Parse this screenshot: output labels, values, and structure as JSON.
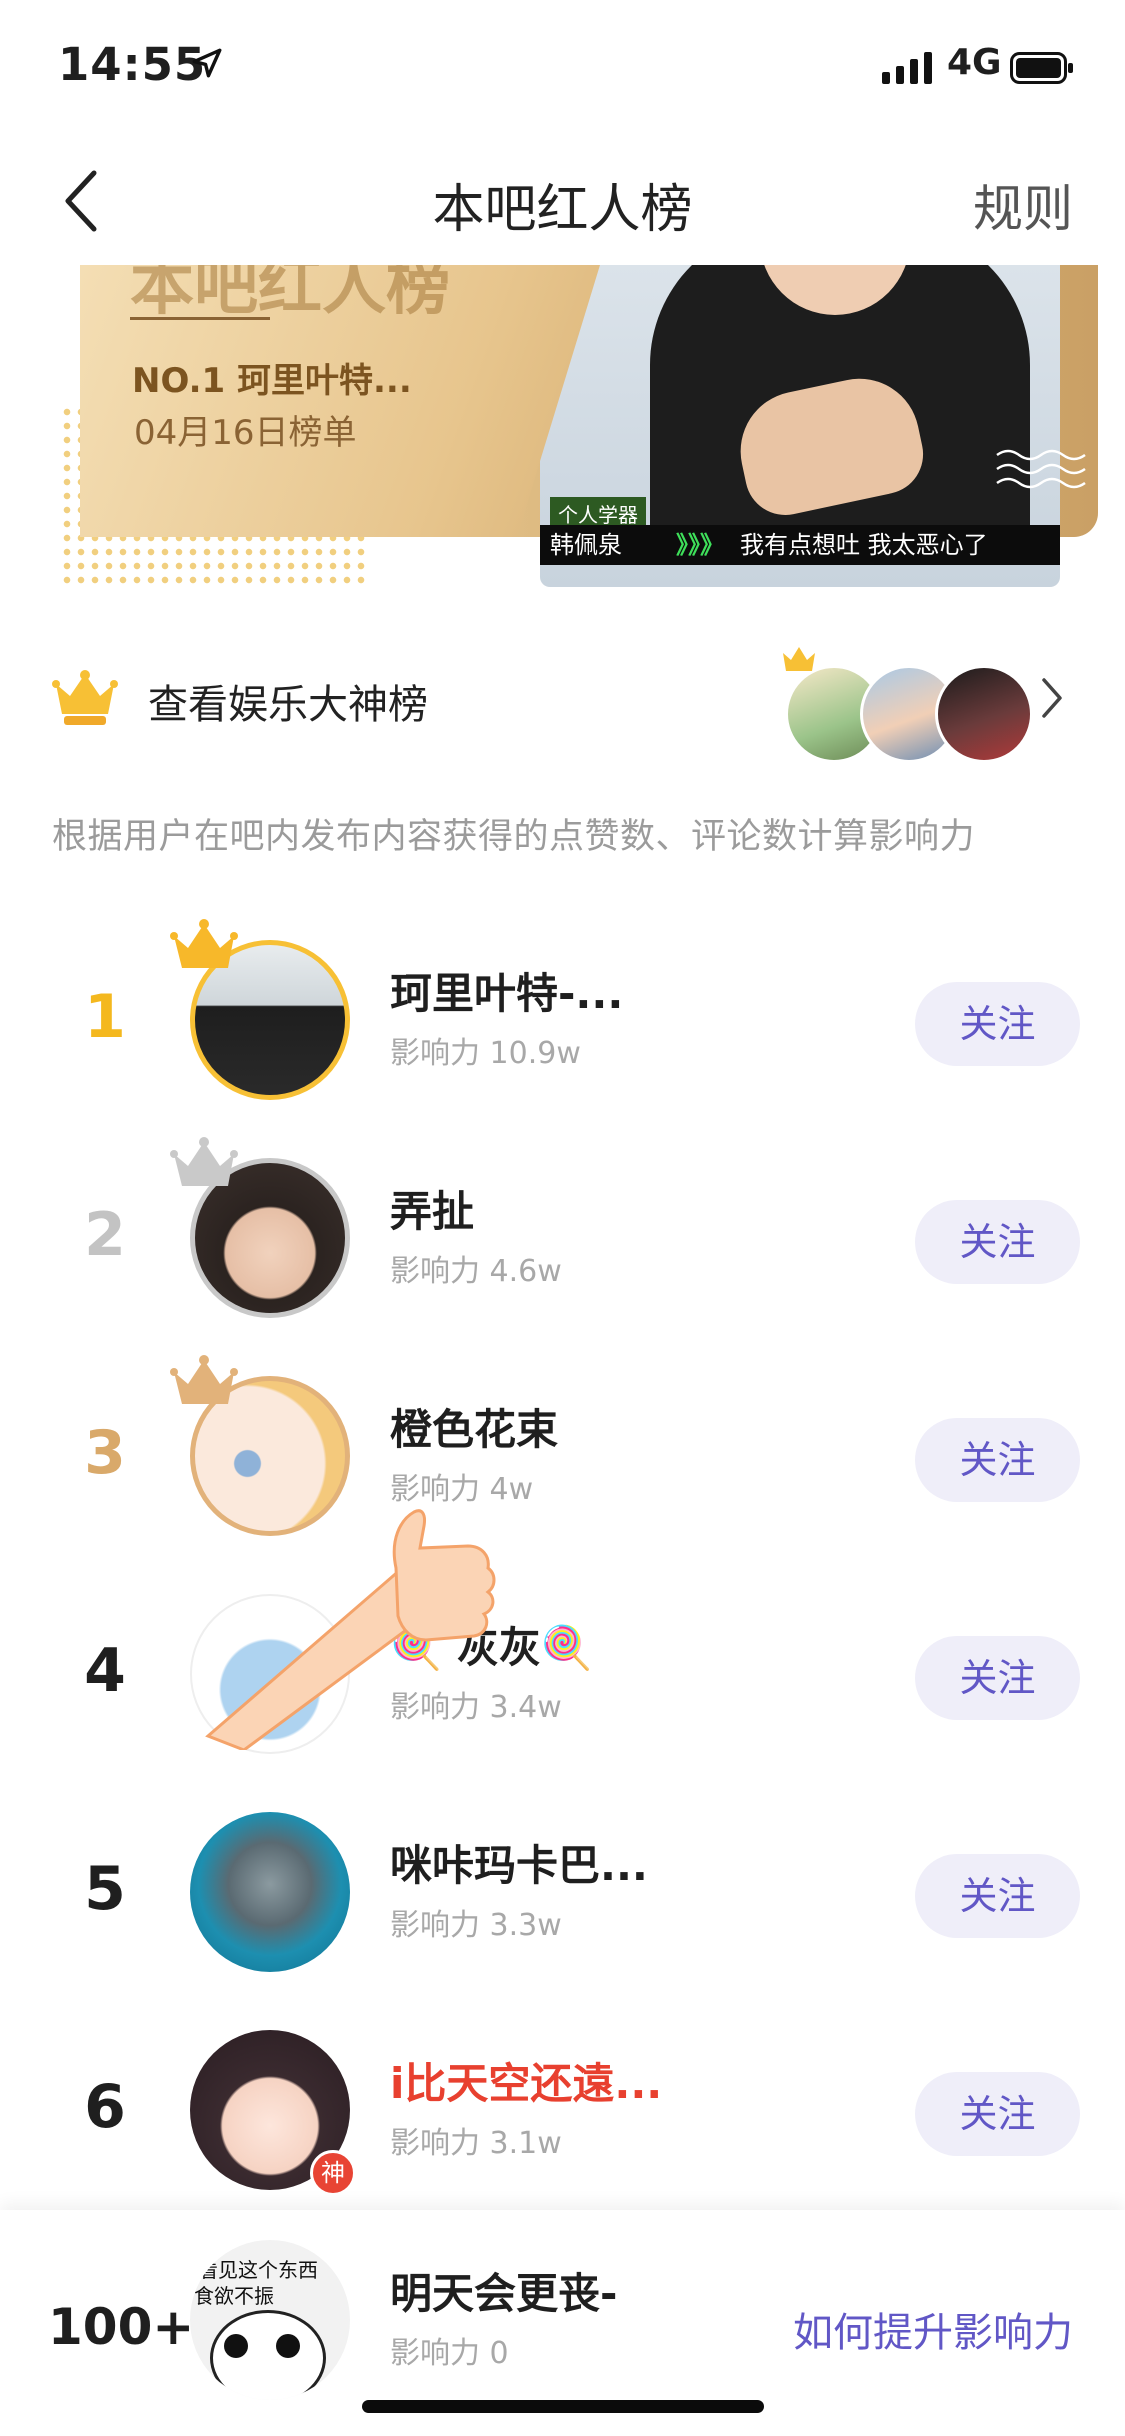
{
  "status_bar": {
    "time": "14:55",
    "network": "4G"
  },
  "nav": {
    "title": "本吧红人榜",
    "rules": "规则"
  },
  "banner": {
    "title": "本吧红人榜",
    "top_user": "NO.1 珂里叶特...",
    "date": "04月16日榜单",
    "caption_tag": "个人学器",
    "caption_name": "韩佩泉",
    "caption_arrows": "》》》",
    "caption_text": "我有点想吐 我太恶心了"
  },
  "entertainment": {
    "label": "查看娱乐大神榜"
  },
  "description": "根据用户在吧内发布内容获得的点赞数、评论数计算影响力",
  "ranking": [
    {
      "rank": "1",
      "name": "珂里叶特-...",
      "influence": "影响力 10.9w",
      "follow": "关注",
      "rank_color": "#f4b81e",
      "name_color": "#1f1f1f"
    },
    {
      "rank": "2",
      "name": "弄扯",
      "influence": "影响力 4.6w",
      "follow": "关注",
      "rank_color": "#c3c3c3",
      "name_color": "#1f1f1f"
    },
    {
      "rank": "3",
      "name": "橙色花束",
      "influence": "影响力 4w",
      "follow": "关注",
      "rank_color": "#d9a96a",
      "name_color": "#1f1f1f"
    },
    {
      "rank": "4",
      "name": "🍭 灰灰🍭",
      "influence": "影响力 3.4w",
      "follow": "关注",
      "rank_color": "#1f1f1f",
      "name_color": "#1f1f1f"
    },
    {
      "rank": "5",
      "name": "咪咔玛卡巴...",
      "influence": "影响力 3.3w",
      "follow": "关注",
      "rank_color": "#1f1f1f",
      "name_color": "#1f1f1f"
    },
    {
      "rank": "6",
      "name": "i比天空还遠...",
      "influence": "影响力 3.1w",
      "follow": "关注",
      "rank_color": "#1f1f1f",
      "name_color": "#e8402f",
      "badge": "神"
    }
  ],
  "me": {
    "rank": "100+",
    "name": "明天会更丧-",
    "influence": "影响力 0",
    "avatar_text_1": "看见这个东西",
    "avatar_text_2": "食欲不振",
    "how_to": "如何提升影响力"
  },
  "colors": {
    "accent": "#6157c6",
    "follow_bg": "#efeef9",
    "gold": "#dbb57a"
  }
}
